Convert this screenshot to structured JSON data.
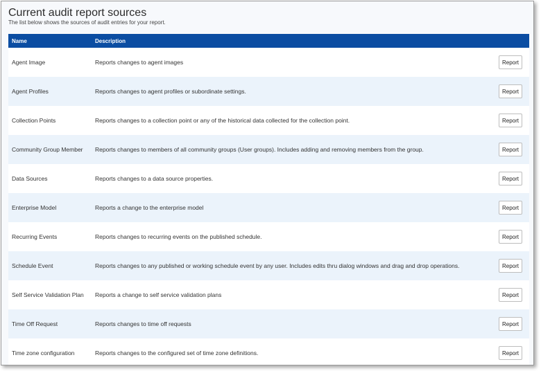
{
  "page": {
    "title": "Current audit report sources",
    "subtitle": "The list below shows the sources of audit entries for your report."
  },
  "table": {
    "headers": {
      "name": "Name",
      "description": "Description"
    },
    "action_label": "Report",
    "rows": [
      {
        "name": "Agent Image",
        "description": "Reports changes to agent images"
      },
      {
        "name": "Agent Profiles",
        "description": "Reports changes to agent profiles or subordinate settings."
      },
      {
        "name": "Collection Points",
        "description": "Reports changes to a collection point or any of the historical data collected for the collection point."
      },
      {
        "name": "Community Group Member",
        "description": "Reports changes to members of all community groups (User groups). Includes adding and removing members from the group."
      },
      {
        "name": "Data Sources",
        "description": "Reports changes to a data source properties."
      },
      {
        "name": "Enterprise Model",
        "description": "Reports a change to the enterprise model"
      },
      {
        "name": "Recurring Events",
        "description": "Reports changes to recurring events on the published schedule."
      },
      {
        "name": "Schedule Event",
        "description": "Reports changes to any published or working schedule event by any user. Includes edits thru dialog windows and drag and drop operations."
      },
      {
        "name": "Self Service Validation Plan",
        "description": "Reports a change to self service validation plans"
      },
      {
        "name": "Time Off Request",
        "description": "Reports changes to time off requests"
      },
      {
        "name": "Time zone configuration",
        "description": "Reports changes to the configured set of time zone definitions."
      }
    ]
  },
  "colors": {
    "header_bg": "#0b4da2",
    "row_alt_bg": "#ebf3fb"
  }
}
